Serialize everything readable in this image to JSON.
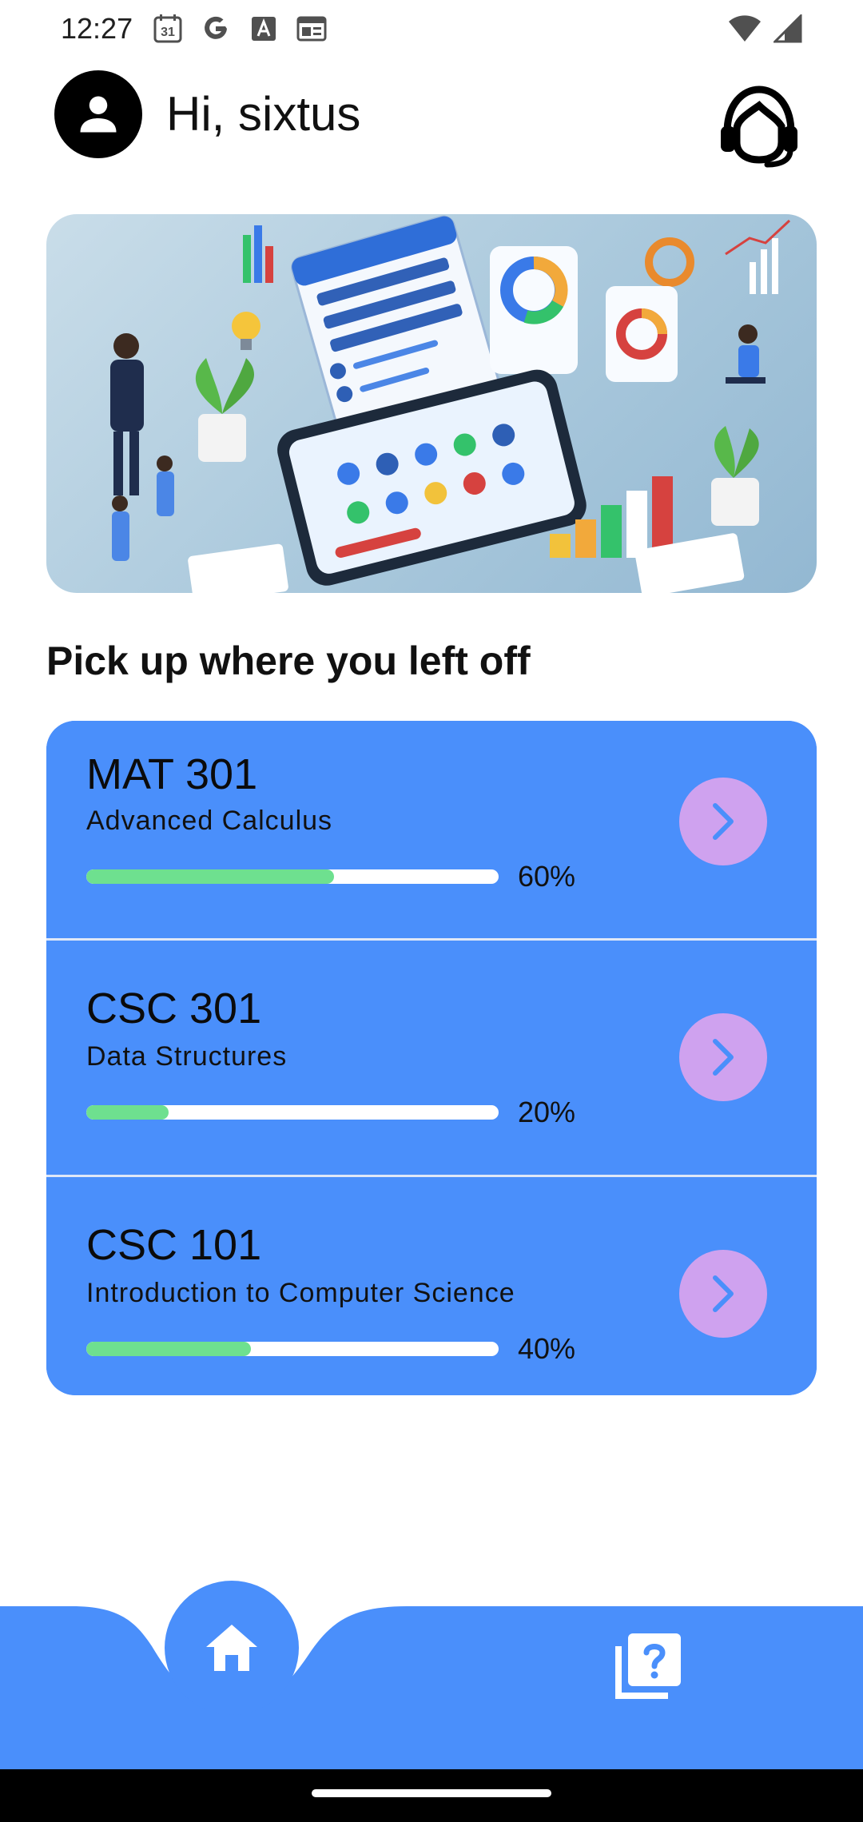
{
  "status_bar": {
    "time": "12:27",
    "calendar_day": "31",
    "left_icons": [
      "calendar-icon",
      "google-icon",
      "font-icon",
      "news-icon"
    ],
    "right_icons": [
      "wifi-icon",
      "cell-signal-icon"
    ]
  },
  "header": {
    "greeting": "Hi, sixtus",
    "avatar_icon": "person-icon",
    "support_icon": "headset-support-icon"
  },
  "banner": {
    "illustration": "quiz-dashboard-illustration"
  },
  "section": {
    "title": "Pick up where you left off"
  },
  "courses": [
    {
      "code": "MAT 301",
      "name": "Advanced Calculus",
      "progress": 0.6,
      "progress_label": "60%"
    },
    {
      "code": "CSC 301",
      "name": "Data Structures",
      "progress": 0.2,
      "progress_label": "20%"
    },
    {
      "code": "CSC 101",
      "name": "Introduction to Computer Science",
      "progress": 0.4,
      "progress_label": "40%"
    }
  ],
  "bottom_nav": {
    "items": [
      {
        "icon": "home-icon",
        "active": true
      },
      {
        "icon": "quiz-icon",
        "active": false
      }
    ]
  },
  "colors": {
    "accent": "#4A8FFB",
    "progress_fill": "#6EE08F",
    "progress_track": "#FFFFFF",
    "arrow_button": "#CFA2EF",
    "arrow": "#4A8FFB"
  }
}
